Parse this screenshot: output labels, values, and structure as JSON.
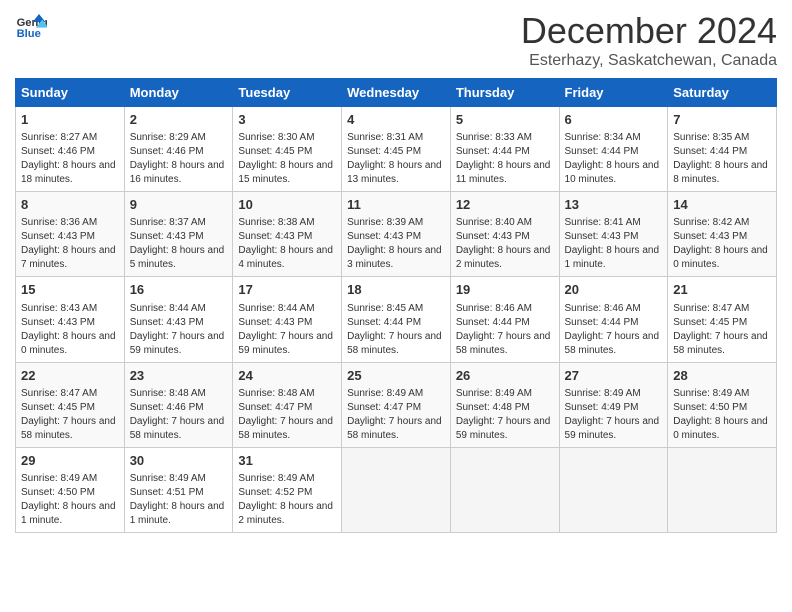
{
  "header": {
    "logo_general": "General",
    "logo_blue": "Blue",
    "month": "December 2024",
    "location": "Esterhazy, Saskatchewan, Canada"
  },
  "days_of_week": [
    "Sunday",
    "Monday",
    "Tuesday",
    "Wednesday",
    "Thursday",
    "Friday",
    "Saturday"
  ],
  "weeks": [
    [
      {
        "day": "1",
        "sunrise": "Sunrise: 8:27 AM",
        "sunset": "Sunset: 4:46 PM",
        "daylight": "Daylight: 8 hours and 18 minutes."
      },
      {
        "day": "2",
        "sunrise": "Sunrise: 8:29 AM",
        "sunset": "Sunset: 4:46 PM",
        "daylight": "Daylight: 8 hours and 16 minutes."
      },
      {
        "day": "3",
        "sunrise": "Sunrise: 8:30 AM",
        "sunset": "Sunset: 4:45 PM",
        "daylight": "Daylight: 8 hours and 15 minutes."
      },
      {
        "day": "4",
        "sunrise": "Sunrise: 8:31 AM",
        "sunset": "Sunset: 4:45 PM",
        "daylight": "Daylight: 8 hours and 13 minutes."
      },
      {
        "day": "5",
        "sunrise": "Sunrise: 8:33 AM",
        "sunset": "Sunset: 4:44 PM",
        "daylight": "Daylight: 8 hours and 11 minutes."
      },
      {
        "day": "6",
        "sunrise": "Sunrise: 8:34 AM",
        "sunset": "Sunset: 4:44 PM",
        "daylight": "Daylight: 8 hours and 10 minutes."
      },
      {
        "day": "7",
        "sunrise": "Sunrise: 8:35 AM",
        "sunset": "Sunset: 4:44 PM",
        "daylight": "Daylight: 8 hours and 8 minutes."
      }
    ],
    [
      {
        "day": "8",
        "sunrise": "Sunrise: 8:36 AM",
        "sunset": "Sunset: 4:43 PM",
        "daylight": "Daylight: 8 hours and 7 minutes."
      },
      {
        "day": "9",
        "sunrise": "Sunrise: 8:37 AM",
        "sunset": "Sunset: 4:43 PM",
        "daylight": "Daylight: 8 hours and 5 minutes."
      },
      {
        "day": "10",
        "sunrise": "Sunrise: 8:38 AM",
        "sunset": "Sunset: 4:43 PM",
        "daylight": "Daylight: 8 hours and 4 minutes."
      },
      {
        "day": "11",
        "sunrise": "Sunrise: 8:39 AM",
        "sunset": "Sunset: 4:43 PM",
        "daylight": "Daylight: 8 hours and 3 minutes."
      },
      {
        "day": "12",
        "sunrise": "Sunrise: 8:40 AM",
        "sunset": "Sunset: 4:43 PM",
        "daylight": "Daylight: 8 hours and 2 minutes."
      },
      {
        "day": "13",
        "sunrise": "Sunrise: 8:41 AM",
        "sunset": "Sunset: 4:43 PM",
        "daylight": "Daylight: 8 hours and 1 minute."
      },
      {
        "day": "14",
        "sunrise": "Sunrise: 8:42 AM",
        "sunset": "Sunset: 4:43 PM",
        "daylight": "Daylight: 8 hours and 0 minutes."
      }
    ],
    [
      {
        "day": "15",
        "sunrise": "Sunrise: 8:43 AM",
        "sunset": "Sunset: 4:43 PM",
        "daylight": "Daylight: 8 hours and 0 minutes."
      },
      {
        "day": "16",
        "sunrise": "Sunrise: 8:44 AM",
        "sunset": "Sunset: 4:43 PM",
        "daylight": "Daylight: 7 hours and 59 minutes."
      },
      {
        "day": "17",
        "sunrise": "Sunrise: 8:44 AM",
        "sunset": "Sunset: 4:43 PM",
        "daylight": "Daylight: 7 hours and 59 minutes."
      },
      {
        "day": "18",
        "sunrise": "Sunrise: 8:45 AM",
        "sunset": "Sunset: 4:44 PM",
        "daylight": "Daylight: 7 hours and 58 minutes."
      },
      {
        "day": "19",
        "sunrise": "Sunrise: 8:46 AM",
        "sunset": "Sunset: 4:44 PM",
        "daylight": "Daylight: 7 hours and 58 minutes."
      },
      {
        "day": "20",
        "sunrise": "Sunrise: 8:46 AM",
        "sunset": "Sunset: 4:44 PM",
        "daylight": "Daylight: 7 hours and 58 minutes."
      },
      {
        "day": "21",
        "sunrise": "Sunrise: 8:47 AM",
        "sunset": "Sunset: 4:45 PM",
        "daylight": "Daylight: 7 hours and 58 minutes."
      }
    ],
    [
      {
        "day": "22",
        "sunrise": "Sunrise: 8:47 AM",
        "sunset": "Sunset: 4:45 PM",
        "daylight": "Daylight: 7 hours and 58 minutes."
      },
      {
        "day": "23",
        "sunrise": "Sunrise: 8:48 AM",
        "sunset": "Sunset: 4:46 PM",
        "daylight": "Daylight: 7 hours and 58 minutes."
      },
      {
        "day": "24",
        "sunrise": "Sunrise: 8:48 AM",
        "sunset": "Sunset: 4:47 PM",
        "daylight": "Daylight: 7 hours and 58 minutes."
      },
      {
        "day": "25",
        "sunrise": "Sunrise: 8:49 AM",
        "sunset": "Sunset: 4:47 PM",
        "daylight": "Daylight: 7 hours and 58 minutes."
      },
      {
        "day": "26",
        "sunrise": "Sunrise: 8:49 AM",
        "sunset": "Sunset: 4:48 PM",
        "daylight": "Daylight: 7 hours and 59 minutes."
      },
      {
        "day": "27",
        "sunrise": "Sunrise: 8:49 AM",
        "sunset": "Sunset: 4:49 PM",
        "daylight": "Daylight: 7 hours and 59 minutes."
      },
      {
        "day": "28",
        "sunrise": "Sunrise: 8:49 AM",
        "sunset": "Sunset: 4:50 PM",
        "daylight": "Daylight: 8 hours and 0 minutes."
      }
    ],
    [
      {
        "day": "29",
        "sunrise": "Sunrise: 8:49 AM",
        "sunset": "Sunset: 4:50 PM",
        "daylight": "Daylight: 8 hours and 1 minute."
      },
      {
        "day": "30",
        "sunrise": "Sunrise: 8:49 AM",
        "sunset": "Sunset: 4:51 PM",
        "daylight": "Daylight: 8 hours and 1 minute."
      },
      {
        "day": "31",
        "sunrise": "Sunrise: 8:49 AM",
        "sunset": "Sunset: 4:52 PM",
        "daylight": "Daylight: 8 hours and 2 minutes."
      },
      null,
      null,
      null,
      null
    ]
  ]
}
